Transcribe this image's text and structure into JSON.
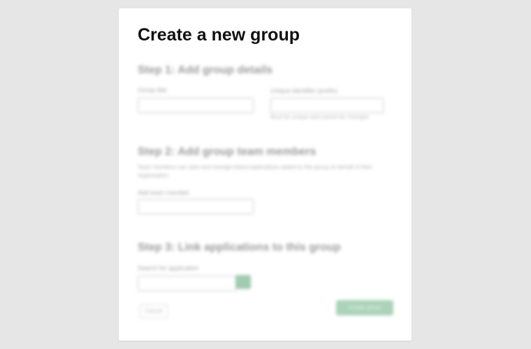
{
  "dialog": {
    "title": "Create a new group",
    "step1": {
      "heading": "Step 1: Add group details",
      "group_title_label": "Group title",
      "group_title_value": "",
      "identifier_label": "Unique identifier (prefix)",
      "identifier_value": "",
      "identifier_hint": "Must be unique and cannot be changed"
    },
    "step2": {
      "heading": "Step 2: Add group team members",
      "description": "Team members can view and manage linked applications added to this group on behalf of their organisation.",
      "members_label": "Add team member",
      "members_value": ""
    },
    "step3": {
      "heading": "Step 3: Link applications to this group",
      "apps_label": "Search for application",
      "apps_value": ""
    },
    "cancel_label": "Cancel",
    "create_label": "Create group"
  },
  "colors": {
    "background": "#e6e6e6",
    "card": "#ffffff",
    "accent": "#aad3b9"
  }
}
